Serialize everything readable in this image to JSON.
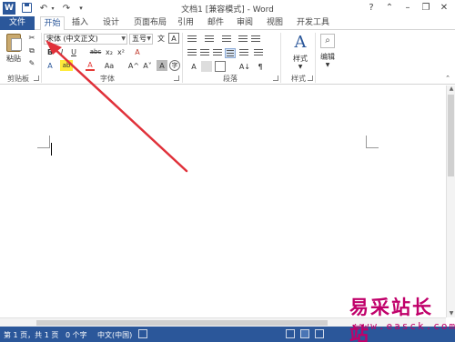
{
  "window": {
    "title": "文档1 [兼容模式] - Word",
    "help": "?",
    "minimize": "–",
    "restore": "❐",
    "close": "✕",
    "ribbon_display": "⌃"
  },
  "quick_access": {
    "undo": "↶",
    "redo": "↷",
    "customize": "▾"
  },
  "tabs": {
    "file": "文件",
    "items": [
      {
        "label": "开始",
        "active": true
      },
      {
        "label": "插入"
      },
      {
        "label": "设计"
      },
      {
        "label": "页面布局"
      },
      {
        "label": "引用"
      },
      {
        "label": "邮件"
      },
      {
        "label": "审阅"
      },
      {
        "label": "视图"
      },
      {
        "label": "开发工具"
      }
    ]
  },
  "ribbon": {
    "clipboard": {
      "paste": "粘贴",
      "cut": "✂",
      "copy": "⧉",
      "format_painter": "✎",
      "label": "剪贴板"
    },
    "font": {
      "font_name": "宋体 (中文正文)",
      "font_size": "五号",
      "bold": "B",
      "italic": "I",
      "underline": "U",
      "strike": "abc",
      "subscript": "x₂",
      "superscript": "x²",
      "clear": "A",
      "grow": "A^",
      "shrink": "A˅",
      "change_case": "Aa",
      "text_effect": "A",
      "highlight": "ab",
      "font_color": "A",
      "phonetic": "文",
      "char_border": "A",
      "char_shading": "A",
      "enclose": "字",
      "label": "字体"
    },
    "paragraph": {
      "label": "段落",
      "show_marks": "¶",
      "sort": "A↓"
    },
    "styles": {
      "label": "样式",
      "styles_button": "样式"
    },
    "editing": {
      "label": "编辑"
    }
  },
  "status": {
    "page": "第 1 页，共 1 页",
    "words": "0 个字",
    "lang": "中文(中国)",
    "zoom_minus": "–",
    "zoom_plus": "+"
  },
  "watermark": {
    "cn": "易采站长站",
    "url": "www.easck.com"
  },
  "colors": {
    "accent": "#2b579a",
    "arrow": "#e0313a",
    "watermark": "#c0006a"
  }
}
